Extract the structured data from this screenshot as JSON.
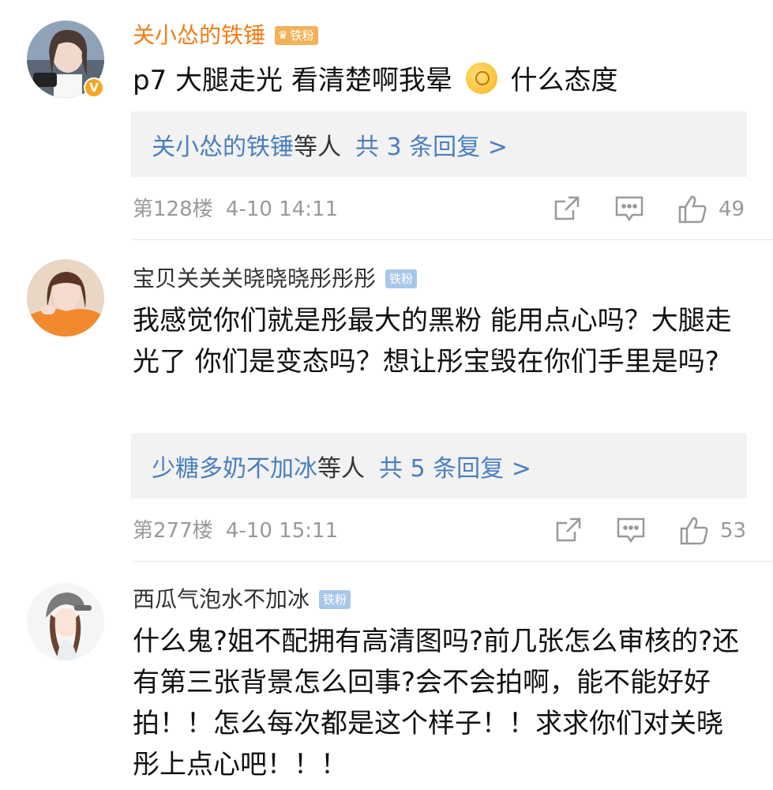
{
  "comments": [
    {
      "user": "关小怂的铁锤",
      "badge": "铁粉",
      "text_before": "p7 大腿走光 看清楚啊我晕 ",
      "text_after": " 什么态度",
      "emoji": "dizzy-emoji",
      "reply_users": "关小怂的铁锤",
      "reply_suffix": "等人",
      "reply_count": "共 3 条回复 >",
      "floor": "第128楼",
      "time": "4-10 14:11",
      "likes": "49"
    },
    {
      "user": "宝贝关关关晓晓晓彤彤彤",
      "badge": "铁粉",
      "text": "我感觉你们就是彤最大的黑粉 能用点心吗？大腿走光了 你们是变态吗？想让彤宝毁在你们手里是吗?",
      "reply_users": "少糖多奶不加冰",
      "reply_suffix": "等人",
      "reply_count": "共 5 条回复 >",
      "floor": "第277楼",
      "time": "4-10 15:11",
      "likes": "53"
    },
    {
      "user": "西瓜气泡水不加冰",
      "badge": "铁粉",
      "text": "什么鬼?姐不配拥有高清图吗?前几张怎么审核的?还有第三张背景怎么回事?会不会拍啊，能不能好好拍！！怎么每次都是这个样子！！求求你们对关晓彤上点心吧！！！"
    }
  ],
  "colors": {
    "vip_name": "#f07d18",
    "link": "#4a7fbf",
    "meta": "#999999",
    "badge": "#a7c8ea"
  }
}
